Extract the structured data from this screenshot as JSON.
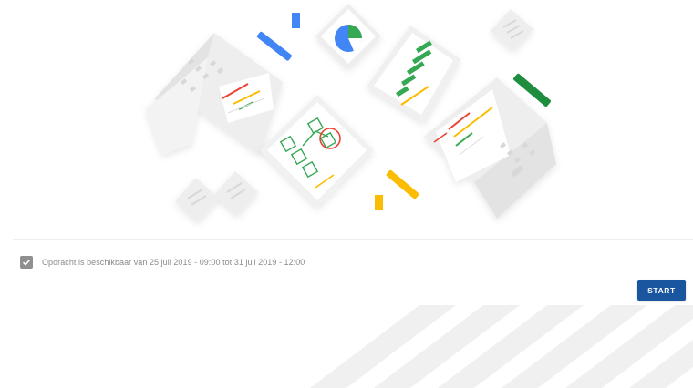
{
  "hero": {
    "illustration_icon": "assignment-illustration-icon"
  },
  "availability": {
    "checked": true,
    "text": "Opdracht is beschikbaar van 25 juli 2019 - 09:00 tot 31 juli 2019 - 12:00"
  },
  "actions": {
    "start_label": "START"
  },
  "colors": {
    "primary_button": "#1a56a0",
    "google_blue": "#4285f4",
    "google_red": "#ea4335",
    "google_yellow": "#fbbc04",
    "google_green": "#34a853"
  }
}
